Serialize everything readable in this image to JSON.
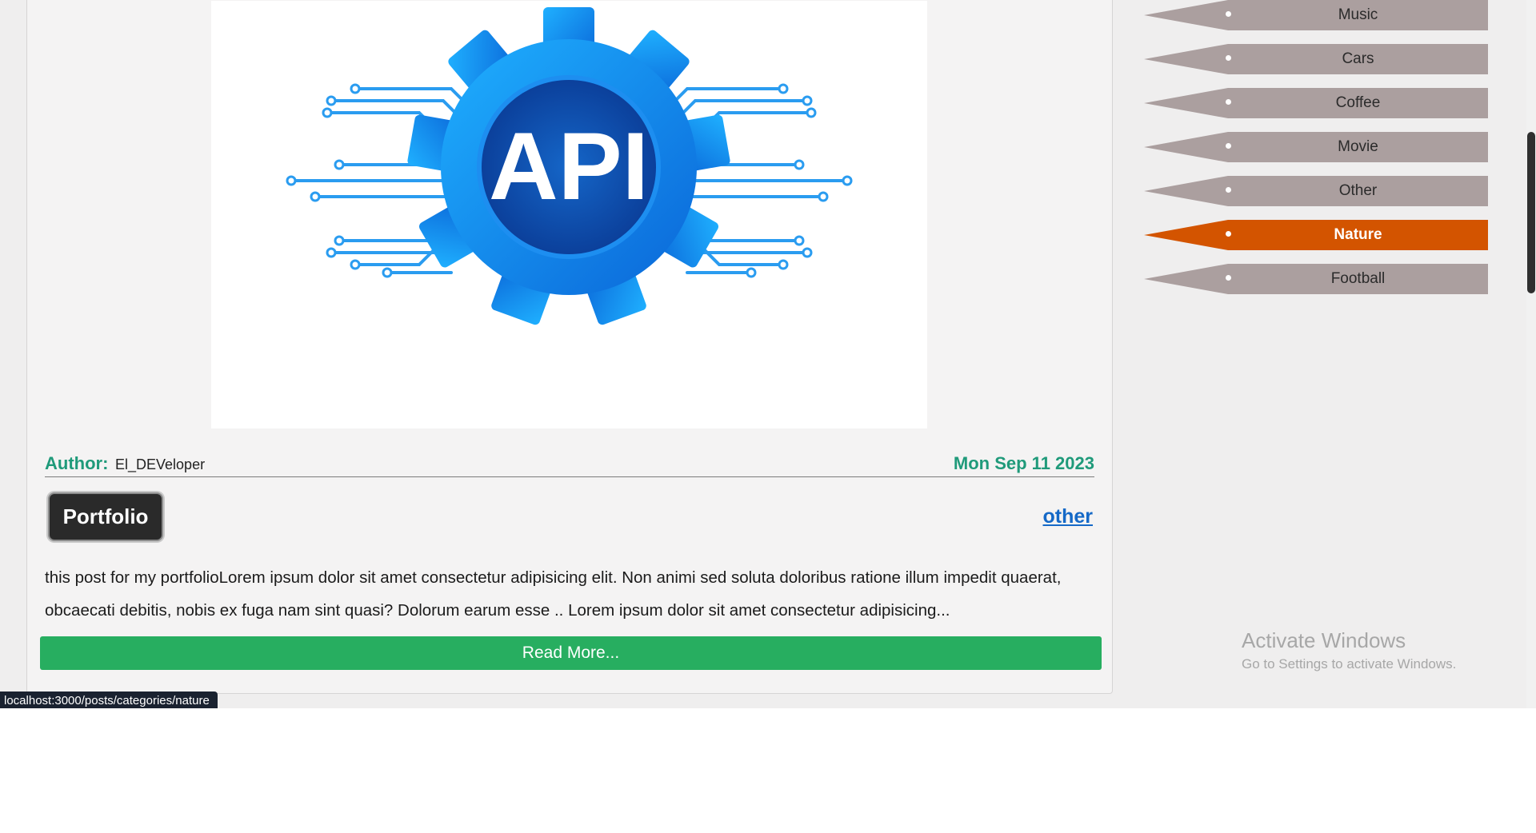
{
  "post": {
    "image_alt": "API",
    "author_label": "Author:",
    "author_name": "El_DEVeloper",
    "date": "Mon Sep 11 2023",
    "tag": "Portfolio",
    "category": "other",
    "excerpt": "this post for my portfolioLorem ipsum dolor sit amet consectetur adipisicing elit. Non animi sed soluta doloribus ratione illum impedit quaerat, obcaecati debitis, nobis ex fuga nam sint quasi? Dolorum earum esse .. Lorem ipsum dolor sit amet consectetur adipisicing...",
    "read_more": "Read More..."
  },
  "categories": {
    "items": [
      {
        "label": "Music",
        "active": false
      },
      {
        "label": "Cars",
        "active": false
      },
      {
        "label": "Coffee",
        "active": false
      },
      {
        "label": "Movie",
        "active": false
      },
      {
        "label": "Other",
        "active": false
      },
      {
        "label": "Nature",
        "active": true
      },
      {
        "label": "Football",
        "active": false
      }
    ]
  },
  "watermark": {
    "title": "Activate Windows",
    "subtitle": "Go to Settings to activate Windows."
  },
  "status_bar": {
    "url": "localhost:3000/posts/categories/nature"
  },
  "colors": {
    "accent_green": "#27ae60",
    "meta_teal": "#1f9a7a",
    "active_category": "#d35400",
    "category_bg": "#ab9f9f",
    "link_blue": "#1569c7"
  }
}
